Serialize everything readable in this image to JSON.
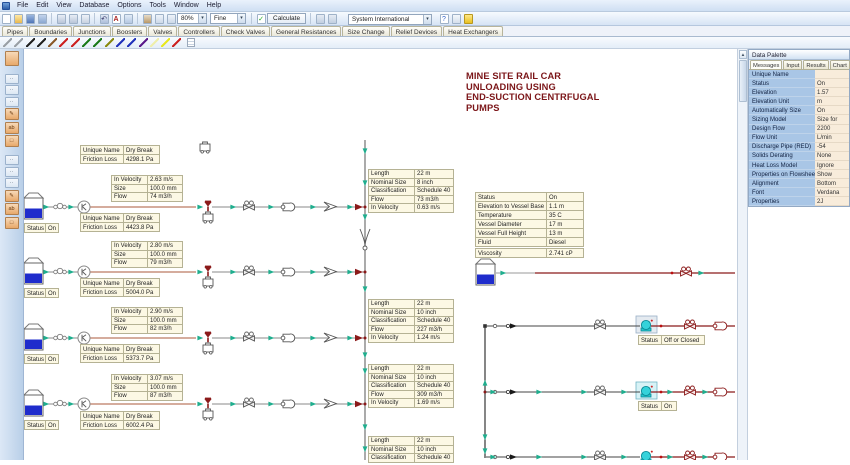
{
  "menu": {
    "items": [
      "File",
      "Edit",
      "View",
      "Database",
      "Options",
      "Tools",
      "Window",
      "Help"
    ]
  },
  "toolbar": {
    "zoom_value": "80%",
    "detail_value": "Fine",
    "calculate_label": "Calculate",
    "units_value": "System International"
  },
  "tabs": [
    "Pipes",
    "Boundaries",
    "Junctions",
    "Boosters",
    "Valves",
    "Controllers",
    "Check Valves",
    "General Resistances",
    "Size Change",
    "Relief Devices",
    "Heat Exchangers"
  ],
  "pen_colors": [
    {
      "color": "#9aa0a6"
    },
    {
      "color": "#9aa0a6"
    },
    {
      "color": "#222222"
    },
    {
      "color": "#222222"
    },
    {
      "color": "#8a5a2b"
    },
    {
      "color": "#cc2222"
    },
    {
      "color": "#cc2222"
    },
    {
      "color": "#1a7a1a"
    },
    {
      "color": "#1a7a1a"
    },
    {
      "color": "#8a8a10"
    },
    {
      "color": "#2233bb"
    },
    {
      "color": "#2233bb"
    },
    {
      "color": "#5a1a8a"
    },
    {
      "color": "#eeeeaa"
    },
    {
      "color": "#e8e820"
    },
    {
      "color": "#cc2222"
    }
  ],
  "annotation_title": {
    "lines": [
      "MINE SITE RAIL CAR",
      "UNLOADING USING",
      "END-SUCTION CENTRFUGAL",
      "PUMPS"
    ]
  },
  "tank_labels": [
    {
      "rows": [
        [
          "Status",
          "On"
        ]
      ]
    },
    {
      "rows": [
        [
          "Status",
          "On"
        ]
      ]
    },
    {
      "rows": [
        [
          "Status",
          "On"
        ]
      ]
    },
    {
      "rows": [
        [
          "Status",
          "On"
        ]
      ]
    }
  ],
  "dry_break_tables": [
    {
      "rows": [
        [
          "Unique Name",
          "Dry Break"
        ],
        [
          "Friction Loss",
          "4298.1 Pa"
        ]
      ]
    },
    {
      "rows": [
        [
          "Unique Name",
          "Dry Break"
        ],
        [
          "Friction Loss",
          "4423.8 Pa"
        ]
      ]
    },
    {
      "rows": [
        [
          "Unique Name",
          "Dry Break"
        ],
        [
          "Friction Loss",
          "5004.0 Pa"
        ]
      ]
    },
    {
      "rows": [
        [
          "Unique Name",
          "Dry Break"
        ],
        [
          "Friction Loss",
          "5373.7 Pa"
        ]
      ]
    },
    {
      "rows": [
        [
          "Unique Name",
          "Dry Break"
        ],
        [
          "Friction Loss",
          "6002.4 Pa"
        ]
      ]
    }
  ],
  "velocity_tables": [
    {
      "rows": [
        [
          "In Velocity",
          "2.63 m/s"
        ],
        [
          "Size",
          "100.0 mm"
        ],
        [
          "Flow",
          "74 m3/h"
        ]
      ]
    },
    {
      "rows": [
        [
          "In Velocity",
          "2.80 m/s"
        ],
        [
          "Size",
          "100.0 mm"
        ],
        [
          "Flow",
          "79 m3/h"
        ]
      ]
    },
    {
      "rows": [
        [
          "In Velocity",
          "2.90 m/s"
        ],
        [
          "Size",
          "100.0 mm"
        ],
        [
          "Flow",
          "82 m3/h"
        ]
      ]
    },
    {
      "rows": [
        [
          "In Velocity",
          "3.07 m/s"
        ],
        [
          "Size",
          "100.0 mm"
        ],
        [
          "Flow",
          "87 m3/h"
        ]
      ]
    }
  ],
  "pipe_tables": [
    {
      "rows": [
        [
          "Length",
          "22 m"
        ],
        [
          "Nominal Size",
          "8 inch"
        ],
        [
          "Classification",
          "Schedule 40"
        ],
        [
          "Flow",
          "73 m3/h"
        ],
        [
          "In Velocity",
          "0.63 m/s"
        ]
      ]
    },
    {
      "rows": [
        [
          "Length",
          "22 m"
        ],
        [
          "Nominal Size",
          "10 inch"
        ],
        [
          "Classification",
          "Schedule 40"
        ],
        [
          "Flow",
          "227 m3/h"
        ],
        [
          "In Velocity",
          "1.24 m/s"
        ]
      ]
    },
    {
      "rows": [
        [
          "Length",
          "22 m"
        ],
        [
          "Nominal Size",
          "10 inch"
        ],
        [
          "Classification",
          "Schedule 40"
        ],
        [
          "Flow",
          "309 m3/h"
        ],
        [
          "In Velocity",
          "1.69 m/s"
        ]
      ]
    },
    {
      "rows": [
        [
          "Length",
          "22 m"
        ],
        [
          "Nominal Size",
          "10 inch"
        ],
        [
          "Classification",
          "Schedule 40"
        ]
      ]
    }
  ],
  "vessel_table": {
    "rows": [
      [
        "Status",
        "On"
      ],
      [
        "Elevation to Vessel Base",
        "1.1 m"
      ],
      [
        "Temperature",
        "35 C"
      ],
      [
        "Vessel Diameter",
        "17 m"
      ],
      [
        "Vessel Full Height",
        "13 m"
      ],
      [
        "Fluid",
        "Diesel"
      ],
      [
        "Viscosity",
        "2.741 cP"
      ]
    ]
  },
  "pump_labels": [
    {
      "rows": [
        [
          "Status",
          "Off or Closed"
        ]
      ]
    },
    {
      "rows": [
        [
          "Status",
          "On"
        ]
      ]
    }
  ],
  "palette": {
    "title": "Data Palette",
    "tabs": [
      "Messages",
      "Input",
      "Results",
      "Chart"
    ],
    "rows": [
      [
        "Unique Name",
        ""
      ],
      [
        "Status",
        "On"
      ],
      [
        "Elevation",
        "1.57"
      ],
      [
        "Elevation Unit",
        "m"
      ],
      [
        "Automatically Size",
        "On"
      ],
      [
        "Sizing Model",
        "Size for"
      ],
      [
        "Design Flow",
        "2200"
      ],
      [
        "Flow Unit",
        "L/min"
      ],
      [
        "Discharge Pipe (RED)",
        "-54"
      ],
      [
        "Solids Derating",
        "None"
      ],
      [
        "Heat Loss Model",
        "Ignore"
      ],
      [
        "Properties on Flowsheet",
        "Show"
      ],
      [
        "Alignment",
        "Bottom"
      ],
      [
        "Font",
        "Verdana"
      ],
      [
        "Properties",
        "2J"
      ]
    ]
  }
}
